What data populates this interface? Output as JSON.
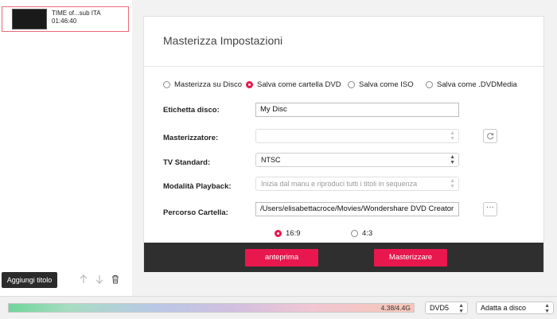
{
  "colors": {
    "accent": "#e8174d",
    "dark_footer": "#2f2f2f"
  },
  "title_list": {
    "items": [
      {
        "name": "TIME of...sub ITA",
        "duration": "01:46:40"
      }
    ],
    "add_title_label": "Aggiungi titolo",
    "icons": [
      "arrow-up-icon",
      "arrow-down-icon",
      "trash-icon"
    ]
  },
  "burn_settings": {
    "title": "Masterizza Impostazioni",
    "output_options": [
      {
        "label": "Masterizza su Disco",
        "selected": false
      },
      {
        "label": "Salva come cartella DVD",
        "selected": true
      },
      {
        "label": "Salva come ISO",
        "selected": false
      },
      {
        "label": "Salva come .DVDMedia",
        "selected": false
      }
    ],
    "disc_label": {
      "label": "Etichetta disco:",
      "value": "My Disc"
    },
    "burner": {
      "label": "Masterizzatore:",
      "value": ""
    },
    "tv_standard": {
      "label": "TV Standard:",
      "value": "NTSC"
    },
    "playback_mode": {
      "label": "Modalità Playback:",
      "value": "Inizia dal manu e riproduci tutti i titoli in sequenza"
    },
    "folder_path": {
      "label": "Percorso Cartella:",
      "value": "/Users/elisabettacroce/Movies/Wondershare DVD Creator",
      "browse_label": "···"
    },
    "aspect_ratio": [
      {
        "label": "16:9",
        "selected": true
      },
      {
        "label": "4:3",
        "selected": false
      }
    ],
    "preview_label": "anteprima",
    "burn_label": "Masterizzare"
  },
  "status_bar": {
    "capacity_text": "4.38/4.4G",
    "capacity_fraction": 0.995,
    "disc_type": "DVD5",
    "fit_mode": "Adatta a disco"
  }
}
